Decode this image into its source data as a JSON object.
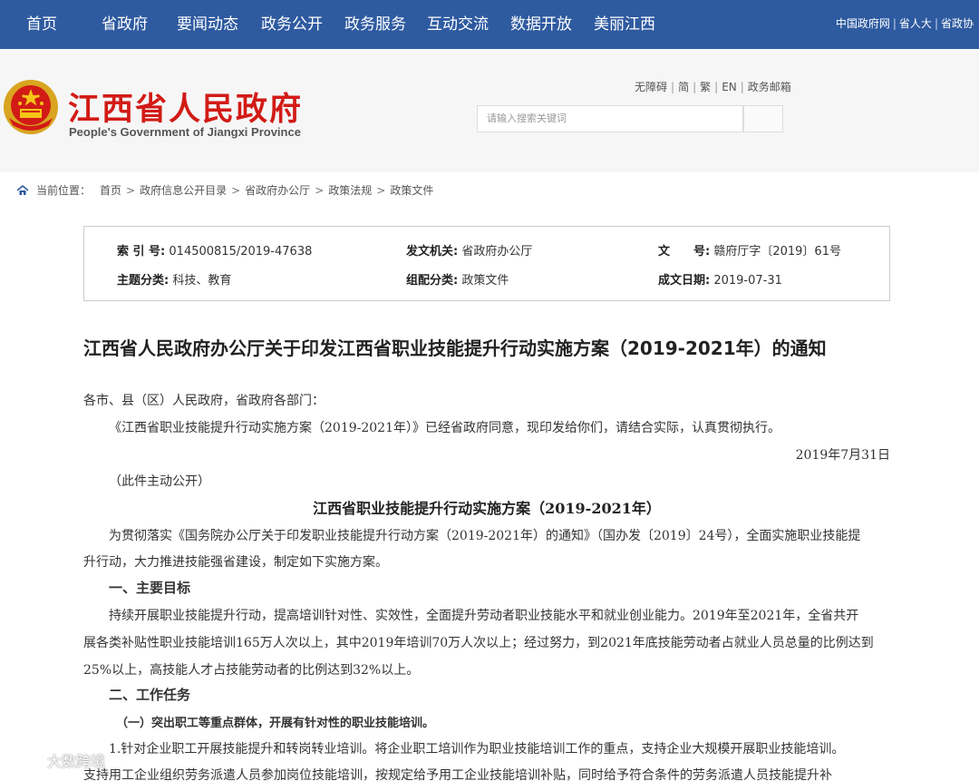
{
  "topnav": {
    "items": [
      "首页",
      "省政府",
      "要闻动态",
      "政务公开",
      "政务服务",
      "互动交流",
      "数据开放",
      "美丽江西"
    ],
    "right_links": [
      "中国政府网",
      "省人大",
      "省政协"
    ]
  },
  "header": {
    "logo_cn": "江西省人民政府",
    "logo_en": "People's Government of Jiangxi Province",
    "tools": [
      "无障碍",
      "简",
      "繁",
      "EN",
      "政务邮箱"
    ],
    "search_placeholder": "请输入搜索关键词"
  },
  "breadcrumb": {
    "label": "当前位置：",
    "items": [
      "首页",
      "政府信息公开目录",
      "省政府办公厅",
      "政策法规",
      "政策文件"
    ]
  },
  "meta": {
    "index_label": "索 引 号:",
    "index_value": "014500815/2019-47638",
    "issuer_label": "发文机关:",
    "issuer_value": "省政府办公厅",
    "docno_label": "文　　号:",
    "docno_value": "赣府厅字〔2019〕61号",
    "topic_label": "主题分类:",
    "topic_value": "科技、教育",
    "category_label": "组配分类:",
    "category_value": "政策文件",
    "date_label": "成文日期:",
    "date_value": "2019-07-31"
  },
  "article": {
    "title": "江西省人民政府办公厅关于印发江西省职业技能提升行动实施方案（2019-2021年）的通知",
    "salutation": "各市、县（区）人民政府，省政府各部门：",
    "intro": "《江西省职业技能提升行动实施方案（2019-2021年）》已经省政府同意，现印发给你们，请结合实际，认真贯彻执行。",
    "date": "2019年7月31日",
    "public_note": "（此件主动公开）",
    "subtitle": "江西省职业技能提升行动实施方案（2019-2021年）",
    "para1_line1": "为贯彻落实《国务院办公厅关于印发职业技能提升行动方案（2019-2021年）的通知》（国办发〔2019〕24号），全面实施职业技能提",
    "para1_line2": "升行动，大力推进技能强省建设，制定如下实施方案。",
    "h1": "一、主要目标",
    "para2_line1": "持续开展职业技能提升行动，提高培训针对性、实效性，全面提升劳动者职业技能水平和就业创业能力。2019年至2021年，全省共开",
    "para2_line2": "展各类补贴性职业技能培训165万人次以上，其中2019年培训70万人次以上；经过努力，到2021年底技能劳动者占就业人员总量的比例达到",
    "para2_line3": "25%以上，高技能人才占技能劳动者的比例达到32%以上。",
    "h2": "二、工作任务",
    "h3": "（一）突出职工等重点群体，开展有针对性的职业技能培训。",
    "para3_line1": "1.针对企业职工开展技能提升和转岗转业培训。将企业职工培训作为职业技能培训工作的重点，支持企业大规模开展职业技能培训。",
    "para3_line2": "支持用工企业组织劳务派遣人员参加岗位技能培训，按规定给予用工企业技能培训补贴，同时给予符合条件的劳务派遣人员技能提升补"
  },
  "watermark": {
    "text": "大数跨境"
  },
  "colors": {
    "nav_bg": "#2e5aa0",
    "logo_red": "#d21b16"
  }
}
